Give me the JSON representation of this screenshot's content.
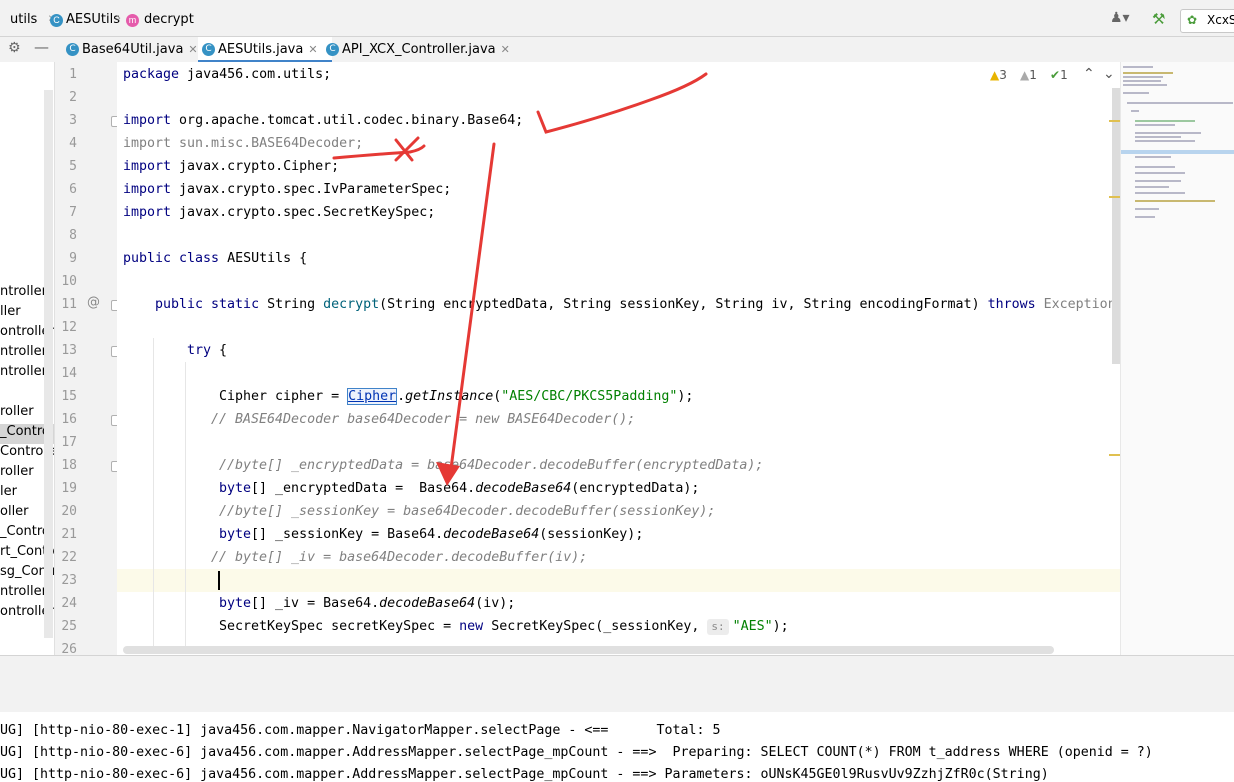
{
  "breadcrumb": {
    "items": [
      "utils",
      "AESUtils",
      "decrypt"
    ]
  },
  "nav_right": {
    "user_icon": "person-icon",
    "build_icon": "hammer-icon",
    "run_config": "XcxS"
  },
  "tabs": [
    {
      "label": "Base64Util.java",
      "active": false
    },
    {
      "label": "AESUtils.java",
      "active": true
    },
    {
      "label": "API_XCX_Controller.java",
      "active": false
    }
  ],
  "project_items": [
    "ntroller",
    "ller",
    "ontroller",
    "ntroller",
    "ntroller",
    "",
    "roller",
    "_Controlle",
    "Controller",
    "roller",
    "ler",
    "oller",
    "_Controlle",
    "rt_Contro",
    "sg_Contro",
    "ntroller",
    "ontroller"
  ],
  "inspections": {
    "warnings": "3",
    "weak_warnings": "1",
    "ok": "1"
  },
  "line_numbers": [
    "1",
    "2",
    "3",
    "4",
    "5",
    "6",
    "7",
    "8",
    "9",
    "10",
    "11",
    "12",
    "13",
    "14",
    "15",
    "16",
    "17",
    "18",
    "19",
    "20",
    "21",
    "22",
    "23",
    "24",
    "25",
    "26"
  ],
  "code": {
    "l1_kw": "package",
    "l1_rest": " java456.com.utils;",
    "l3_kw": "import",
    "l3_rest": " org.apache.tomcat.util.codec.binary.Base64;",
    "l4": "import sun.misc.BASE64Decoder;",
    "l5_kw": "import",
    "l5_rest": " javax.crypto.Cipher;",
    "l6_kw": "import",
    "l6_rest": " javax.crypto.spec.IvParameterSpec;",
    "l7_kw": "import",
    "l7_rest": " javax.crypto.spec.SecretKeySpec;",
    "l9_kw": "public class",
    "l9_rest": " AESUtils {",
    "l11_kw": "public static",
    "l11_a": " String ",
    "l11_fn": "decrypt",
    "l11_b": "(String encryptedData, String sessionKey, String iv, String encodingFormat) ",
    "l11_throws": "throws",
    "l11_exc": " Exception",
    "l13_kw": "try",
    "l13_rest": " {",
    "l15_a": "Cipher cipher = ",
    "l15_hl": "Cipher",
    "l15_dot": ".",
    "l15_m": "getInstance",
    "l15_p1": "(",
    "l15_str": "\"AES/CBC/PKCS5Padding\"",
    "l15_p2": ");",
    "l16": "// BASE64Decoder base64Decoder = new BASE64Decoder();",
    "l18": "//byte[] _encryptedData = base64Decoder.decodeBuffer(encryptedData);",
    "l19_kw": "byte",
    "l19_a": "[] _encryptedData =  Base64.",
    "l19_m": "decodeBase64",
    "l19_b": "(encryptedData);",
    "l20": "//byte[] _sessionKey = base64Decoder.decodeBuffer(sessionKey);",
    "l21_kw": "byte",
    "l21_a": "[] _sessionKey = Base64.",
    "l21_m": "decodeBase64",
    "l21_b": "(sessionKey);",
    "l22": "// byte[] _iv = base64Decoder.decodeBuffer(iv);",
    "l24_kw": "byte",
    "l24_a": "[] _iv = Base64.",
    "l24_m": "decodeBase64",
    "l24_b": "(iv);",
    "l25_a": "SecretKeySpec secretKeySpec = ",
    "l25_kw": "new",
    "l25_b": " SecretKeySpec(_sessionKey, ",
    "l25_hint": "s:",
    "l25_str": "\"AES\"",
    "l25_c": ");"
  },
  "console": [
    "UG] [http-nio-80-exec-1] java456.com.mapper.NavigatorMapper.selectPage - <==      Total: 5",
    "UG] [http-nio-80-exec-6] java456.com.mapper.AddressMapper.selectPage_mpCount - ==>  Preparing: SELECT COUNT(*) FROM t_address WHERE (openid = ?)",
    "UG] [http-nio-80-exec-6] java456.com.mapper.AddressMapper.selectPage_mpCount - ==> Parameters: oUNsK45GE0l9RusvUv9ZzhjZfR0c(String)"
  ],
  "colors": {
    "keyword": "#000080",
    "comment": "#808080",
    "string": "#008000",
    "annotation": "#e53935",
    "active_tab": "#4083c9"
  }
}
